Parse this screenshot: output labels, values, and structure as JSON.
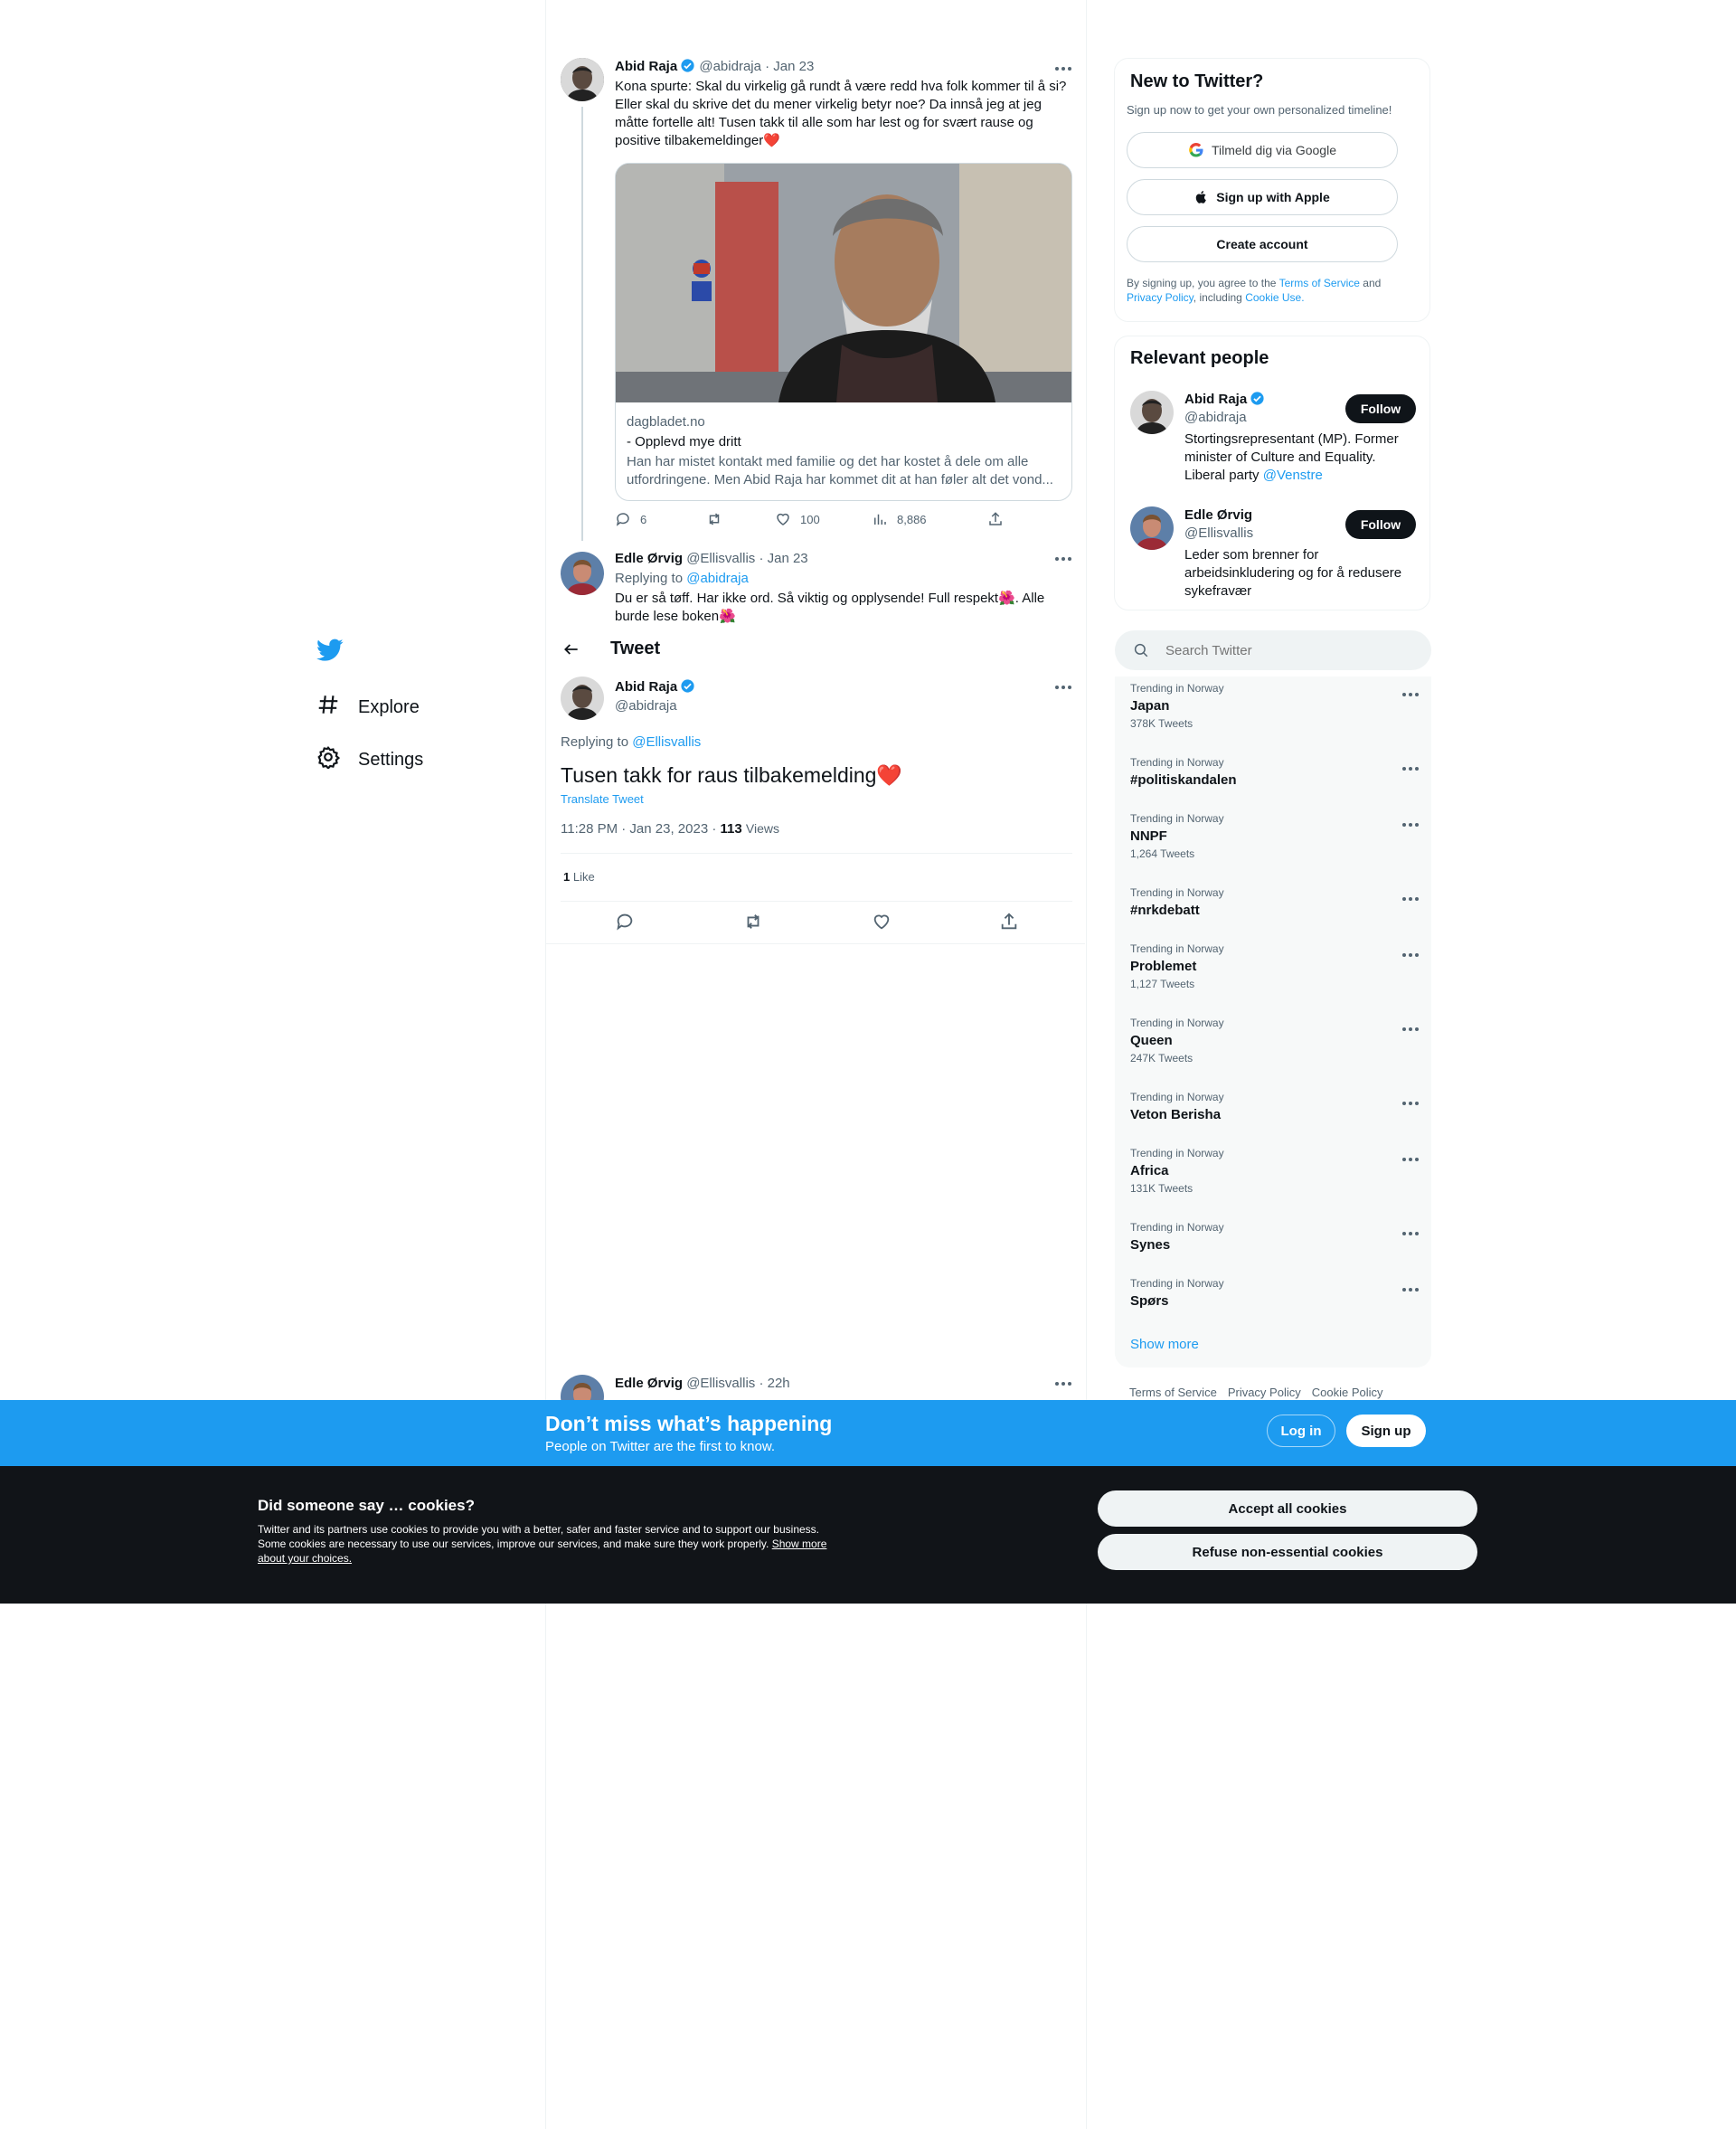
{
  "nav": {
    "items": [
      {
        "label": "Explore",
        "icon": "hashtag-icon"
      },
      {
        "label": "Settings",
        "icon": "gear-icon"
      }
    ]
  },
  "thread": {
    "tweet1": {
      "name": "Abid Raja",
      "handle": "@abidraja",
      "date": "· Jan 23",
      "text": "Kona spurte: Skal du virkelig gå rundt å være redd hva folk kommer til å si? Eller skal du skrive det du mener virkelig betyr noe? Da innså jeg at jeg måtte fortelle alt! Tusen takk til alle som har lest og for svært rause og positive tilbakemeldinger❤️",
      "card": {
        "domain": "dagbladet.no",
        "title": "- Opplevd mye dritt",
        "description": "Han har mistet kontakt med familie og det har kostet å dele om alle utfordringene. Men Abid Raja har kommet dit at han føler alt det vond..."
      },
      "stats": {
        "replies": "6",
        "retweets": "",
        "likes": "100",
        "views": "8,886"
      }
    },
    "tweet2": {
      "name": "Edle Ørvig",
      "handle": "@Ellisvallis",
      "date": "· Jan 23",
      "replying_prefix": "Replying to",
      "replying_to": "@abidraja",
      "text": "Du er så tøff. Har ikke ord. Så viktig og opplysende! Full respekt🌺. Alle burde lese boken🌺"
    },
    "header": {
      "title": "Tweet"
    },
    "main_tweet": {
      "name": "Abid Raja",
      "handle": "@abidraja",
      "replying_prefix": "Replying to",
      "replying_to": "@Ellisvallis",
      "text": "Tusen takk for raus tilbakemelding❤️",
      "translate": "Translate Tweet",
      "timestamp": "11:28 PM · Jan 23, 2023 ·",
      "views_count": "113",
      "views_label": "Views",
      "likes_count": "1",
      "likes_label": "Like"
    },
    "next_reply": {
      "name": "Edle Ørvig",
      "handle": "@Ellisvallis",
      "date": "· 22h"
    }
  },
  "signup": {
    "title": "New to Twitter?",
    "subtitle": "Sign up now to get your own personalized timeline!",
    "google_label": "Tilmeld dig via Google",
    "apple_label": "Sign up with Apple",
    "create_label": "Create account",
    "legal_prefix": "By signing up, you agree to the",
    "terms": "Terms of Service",
    "and": "and",
    "privacy": "Privacy Policy",
    "including": ", including",
    "cookie": "Cookie Use."
  },
  "relevant": {
    "title": "Relevant people",
    "people": [
      {
        "name": "Abid Raja",
        "handle": "@abidraja",
        "bio": "Stortingsrepresentant (MP). Former minister of Culture and Equality. Liberal party",
        "bio_link": "@Venstre",
        "follow": "Follow"
      },
      {
        "name": "Edle Ørvig",
        "handle": "@Ellisvallis",
        "bio": "Leder som brenner for arbeidsinkludering og for å redusere sykefravær",
        "bio_link": "",
        "follow": "Follow"
      }
    ]
  },
  "search": {
    "placeholder": "Search Twitter"
  },
  "trends": {
    "items": [
      {
        "meta": "Trending in Norway",
        "name": "Japan",
        "count": "378K Tweets"
      },
      {
        "meta": "Trending in Norway",
        "name": "#politiskandalen",
        "count": ""
      },
      {
        "meta": "Trending in Norway",
        "name": "NNPF",
        "count": "1,264 Tweets"
      },
      {
        "meta": "Trending in Norway",
        "name": "#nrkdebatt",
        "count": ""
      },
      {
        "meta": "Trending in Norway",
        "name": "Problemet",
        "count": "1,127 Tweets"
      },
      {
        "meta": "Trending in Norway",
        "name": "Queen",
        "count": "247K Tweets"
      },
      {
        "meta": "Trending in Norway",
        "name": "Veton Berisha",
        "count": ""
      },
      {
        "meta": "Trending in Norway",
        "name": "Africa",
        "count": "131K Tweets"
      },
      {
        "meta": "Trending in Norway",
        "name": "Synes",
        "count": ""
      },
      {
        "meta": "Trending in Norway",
        "name": "Spørs",
        "count": ""
      }
    ],
    "show_more": "Show more"
  },
  "footer_links": [
    "Terms of Service",
    "Privacy Policy",
    "Cookie Policy"
  ],
  "bottom_bar": {
    "title": "Don’t miss what’s happening",
    "subtitle": "People on Twitter are the first to know.",
    "login": "Log in",
    "signup": "Sign up"
  },
  "cookies": {
    "title": "Did someone say … cookies?",
    "text": "Twitter and its partners use cookies to provide you with a better, safer and faster service and to support our business. Some cookies are necessary to use our services, improve our services, and make sure they work properly.",
    "link": "Show more about your choices.",
    "accept": "Accept all cookies",
    "refuse": "Refuse non-essential cookies"
  },
  "colors": {
    "brand": "#1d9bf0",
    "dark": "#0f1419",
    "cookie_bg": "#111418"
  }
}
